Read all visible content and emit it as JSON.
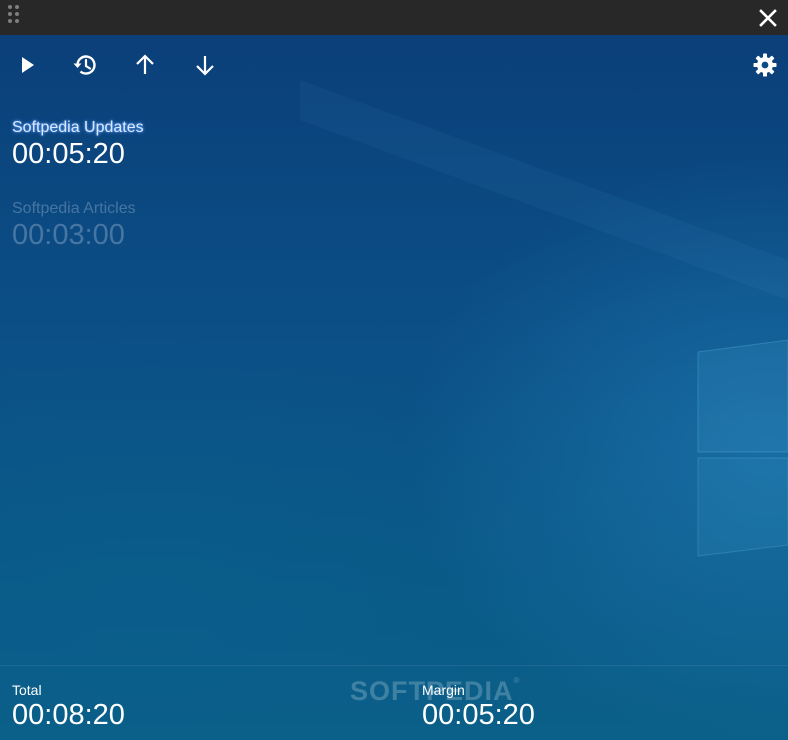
{
  "toolbar": {
    "play_icon": "play-icon",
    "history_icon": "history-icon",
    "up_icon": "arrow-up-icon",
    "down_icon": "arrow-down-icon",
    "settings_icon": "gear-icon"
  },
  "timers": [
    {
      "name": "Softpedia Updates",
      "time": "00:05:20",
      "state": "active"
    },
    {
      "name": "Softpedia Articles",
      "time": "00:03:00",
      "state": "inactive"
    }
  ],
  "footer": {
    "total_label": "Total",
    "total_value": "00:08:20",
    "margin_label": "Margin",
    "margin_value": "00:05:20"
  },
  "watermark": {
    "text": "SOFTPEDIA",
    "mark": "®"
  },
  "colors": {
    "titlebar": "#282828",
    "background": "#0b4f86",
    "active_name_glow": "#3f7fe0"
  }
}
